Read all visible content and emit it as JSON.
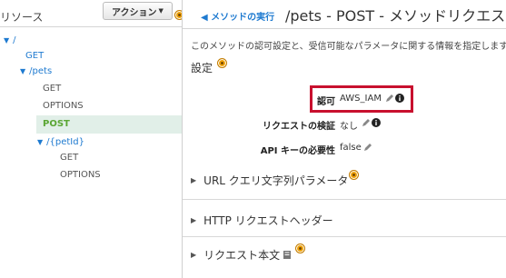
{
  "sidebar": {
    "title": "リソース",
    "action_label": "アクション",
    "tree": {
      "root": "/",
      "root_get": "GET",
      "pets": "/pets",
      "pets_get": "GET",
      "pets_options": "OPTIONS",
      "pets_post": "POST",
      "petid": "/{petId}",
      "petid_get": "GET",
      "petid_options": "OPTIONS"
    }
  },
  "header": {
    "back_label": "メソッドの実行",
    "title": "/pets - POST - メソッドリクエスト"
  },
  "main": {
    "description": "このメソッドの認可設定と、受信可能なパラメータに関する情報を指定します。",
    "settings_title": "設定",
    "fields": {
      "auth_label": "認可",
      "auth_value": "AWS_IAM",
      "validator_label": "リクエストの検証",
      "validator_value": "なし",
      "apikey_label": "API キーの必要性",
      "apikey_value": "false"
    },
    "sections": {
      "query": "URL クエリ文字列パラメータ",
      "headers": "HTTP リクエストヘッダー",
      "body": "リクエスト本文"
    }
  },
  "colors": {
    "link": "#1e7ad0",
    "active_method": "#5aa634",
    "highlight": "#c8102e",
    "help_icon": "#f0a30a"
  }
}
